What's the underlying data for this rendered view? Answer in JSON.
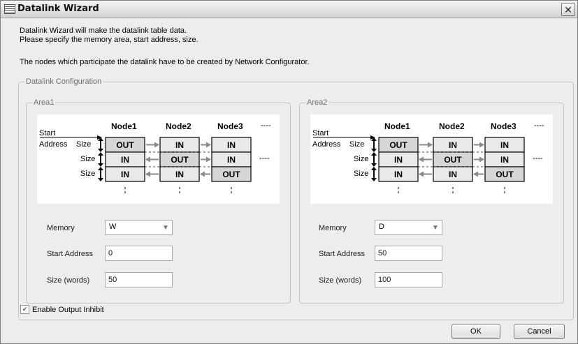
{
  "window": {
    "title": "Datalink Wizard"
  },
  "icons": {
    "app": "table-icon",
    "close": "close-icon",
    "dropdown": "chevron-down-icon",
    "check": "checkmark-icon"
  },
  "intro": {
    "line1": "Datalink Wizard will make the datalink table data.",
    "line2": "Please specify the memory area, start address, size.",
    "line3": "The nodes which participate the datalink have to be created by Network Configurator."
  },
  "datalink_config": {
    "legend": "Datalink Configuration"
  },
  "diagram": {
    "nodes": [
      "Node1",
      "Node2",
      "Node3"
    ],
    "dashes": "----",
    "start_label": "Start",
    "address_label": "Address",
    "size_label": "Size",
    "rows": [
      [
        "OUT",
        "IN",
        "IN"
      ],
      [
        "IN",
        "OUT",
        "IN"
      ],
      [
        "IN",
        "IN",
        "OUT"
      ]
    ]
  },
  "areas": [
    {
      "legend": "Area1",
      "memory_label": "Memory",
      "memory_value": "W",
      "start_label": "Start Address",
      "start_value": "0",
      "size_label": "Size (words)",
      "size_value": "50"
    },
    {
      "legend": "Area2",
      "memory_label": "Memory",
      "memory_value": "D",
      "start_label": "Start Address",
      "start_value": "50",
      "size_label": "Size (words)",
      "size_value": "100"
    }
  ],
  "options": {
    "enable_output_inhibit": "Enable Output Inhibit",
    "enable_output_inhibit_checked": true
  },
  "buttons": {
    "ok": "OK",
    "cancel": "Cancel"
  }
}
